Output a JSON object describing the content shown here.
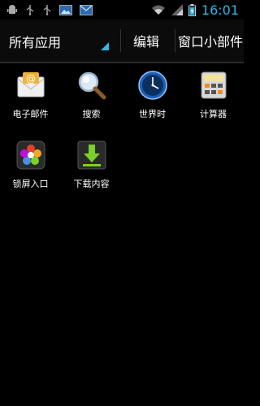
{
  "status_bar": {
    "time": "16:01",
    "left_icons": [
      "android-debug-icon",
      "usb-icon",
      "usb-icon",
      "image-icon",
      "mail-icon"
    ],
    "right_icons": [
      "wifi-icon",
      "signal-icon",
      "battery-icon"
    ],
    "accent": "#33b5e5"
  },
  "action_bar": {
    "title": "所有应用",
    "tab_edit": "编辑",
    "tab_widgets": "窗口小部件"
  },
  "apps": [
    {
      "label": "电子邮件",
      "icon": "email-icon"
    },
    {
      "label": "搜索",
      "icon": "search-icon"
    },
    {
      "label": "世界时",
      "icon": "world-clock-icon"
    },
    {
      "label": "计算器",
      "icon": "calculator-icon"
    },
    {
      "label": "锁屏入口",
      "icon": "lockscreen-icon"
    },
    {
      "label": "下载内容",
      "icon": "download-icon"
    }
  ]
}
